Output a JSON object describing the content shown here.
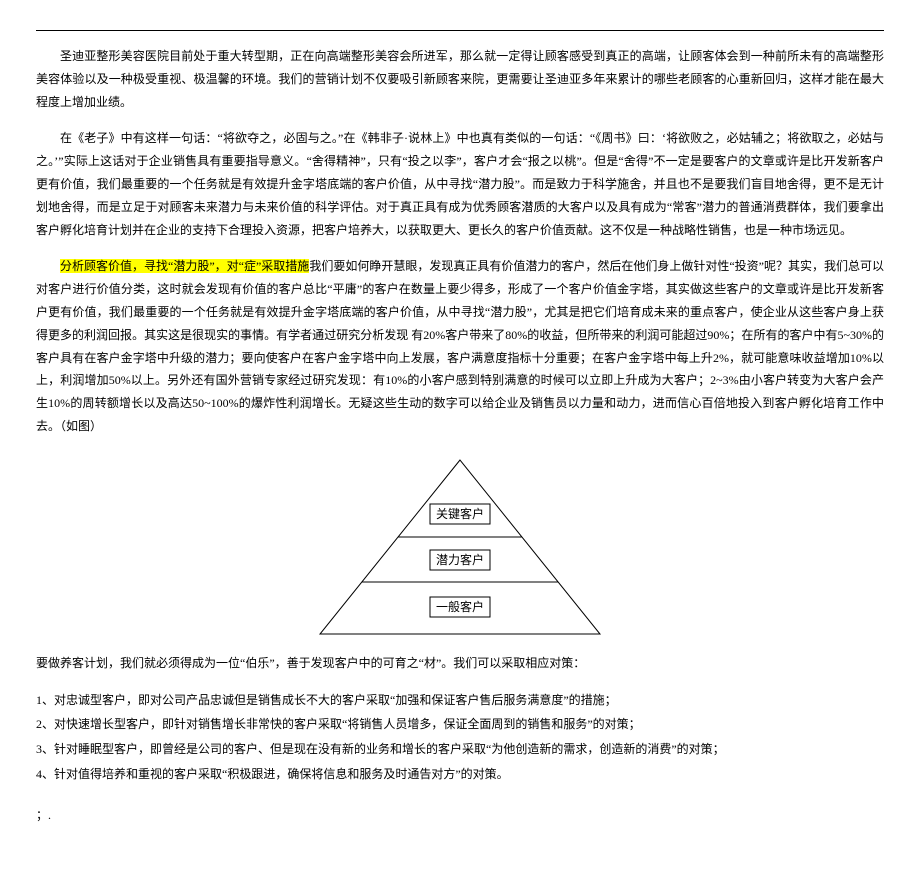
{
  "para1": "圣迪亚整形美容医院目前处于重大转型期，正在向高端整形美容会所进军，那么就一定得让顾客感受到真正的高端，让顾客体会到一种前所未有的高端整形美容体验以及一种极受重视、极温馨的环境。我们的营销计划不仅要吸引新顾客来院，更需要让圣迪亚多年来累计的哪些老顾客的心重新回归，这样才能在最大程度上增加业绩。",
  "para2": "在《老子》中有这样一句话：“将欲夺之，必固与之。”在《韩非子·说林上》中也真有类似的一句话：“《周书》曰：‘将欲败之，必姑辅之；将欲取之，必姑与之。’”实际上这话对于企业销售具有重要指导意义。“舍得精神”，只有“投之以李”，客户才会“报之以桃”。但是“舍得”不一定是要客户的文章或许是比开发新客户更有价值，我们最重要的一个任务就是有效提升金字塔底端的客户价值，从中寻找“潜力股”。而是致力于科学施舍，并且也不是要我们盲目地舍得，更不是无计划地舍得，而是立足于对顾客未来潜力与未来价值的科学评估。对于真正具有成为优秀顾客潜质的大客户以及具有成为“常客”潜力的普通消费群体，我们要拿出客户孵化培育计划并在企业的支持下合理投入资源，把客户培养大，以获取更大、更长久的客户价值贡献。这不仅是一种战略性销售，也是一种市场远见。",
  "para3_highlight": "分析顾客价值，寻找“潜力股”，对“症”采取措施",
  "para3_rest": "我们要如何睁开慧眼，发现真正具有价值潜力的客户，然后在他们身上做针对性“投资”呢？其实，我们总可以对客户进行价值分类，这时就会发现有价值的客户总比“平庸”的客户在数量上要少得多，形成了一个客户价值金字塔，其实做这些客户的文章或许是比开发新客户更有价值，我们最重要的一个任务就是有效提升金字塔底端的客户价值，从中寻找“潜力股”，尤其是把它们培育成未来的重点客户，使企业从这些客户身上获得更多的利润回报。其实这是很现实的事情。有学者通过研究分析发现 有20%客户带来了80%的收益，但所带来的利润可能超过90%；在所有的客户中有5~30%的客户具有在客户金字塔中升级的潜力；要向使客户在客户金字塔中向上发展，客户满意度指标十分重要；在客户金字塔中每上升2%，就可能意味收益增加10%以上，利润增加50%以上。另外还有国外营销专家经过研究发现：有10%的小客户感到特别满意的时候可以立即上升成为大客户；2~3%由小客户转变为大客户会产生10%的周转额增长以及高达50~100%的爆炸性利润增长。无疑这些生动的数字可以给企业及销售员以力量和动力，进而信心百倍地投入到客户孵化培育工作中去。（如图）",
  "pyramid": {
    "top": "关键客户",
    "mid": "潜力客户",
    "bot": "一般客户"
  },
  "para4": "要做养客计划，我们就必须得成为一位“伯乐”，善于发现客户中的可育之“材”。我们可以采取相应对策：",
  "list": {
    "i1": "1、对忠诚型客户，即对公司产品忠诚但是销售成长不大的客户采取“加强和保证客户售后服务满意度”的措施；",
    "i2": "2、对快速增长型客户，即针对销售增长非常快的客户采取“将销售人员增多，保证全面周到的销售和服务”的对策；",
    "i3": "3、针对睡眠型客户，即曾经是公司的客户、但是现在没有新的业务和增长的客户采取“为他创造新的需求，创造新的消费”的对策；",
    "i4": "4、针对值得培养和重视的客户采取“积极跟进，确保将信息和服务及时通告对方”的对策。"
  },
  "footer": "；."
}
